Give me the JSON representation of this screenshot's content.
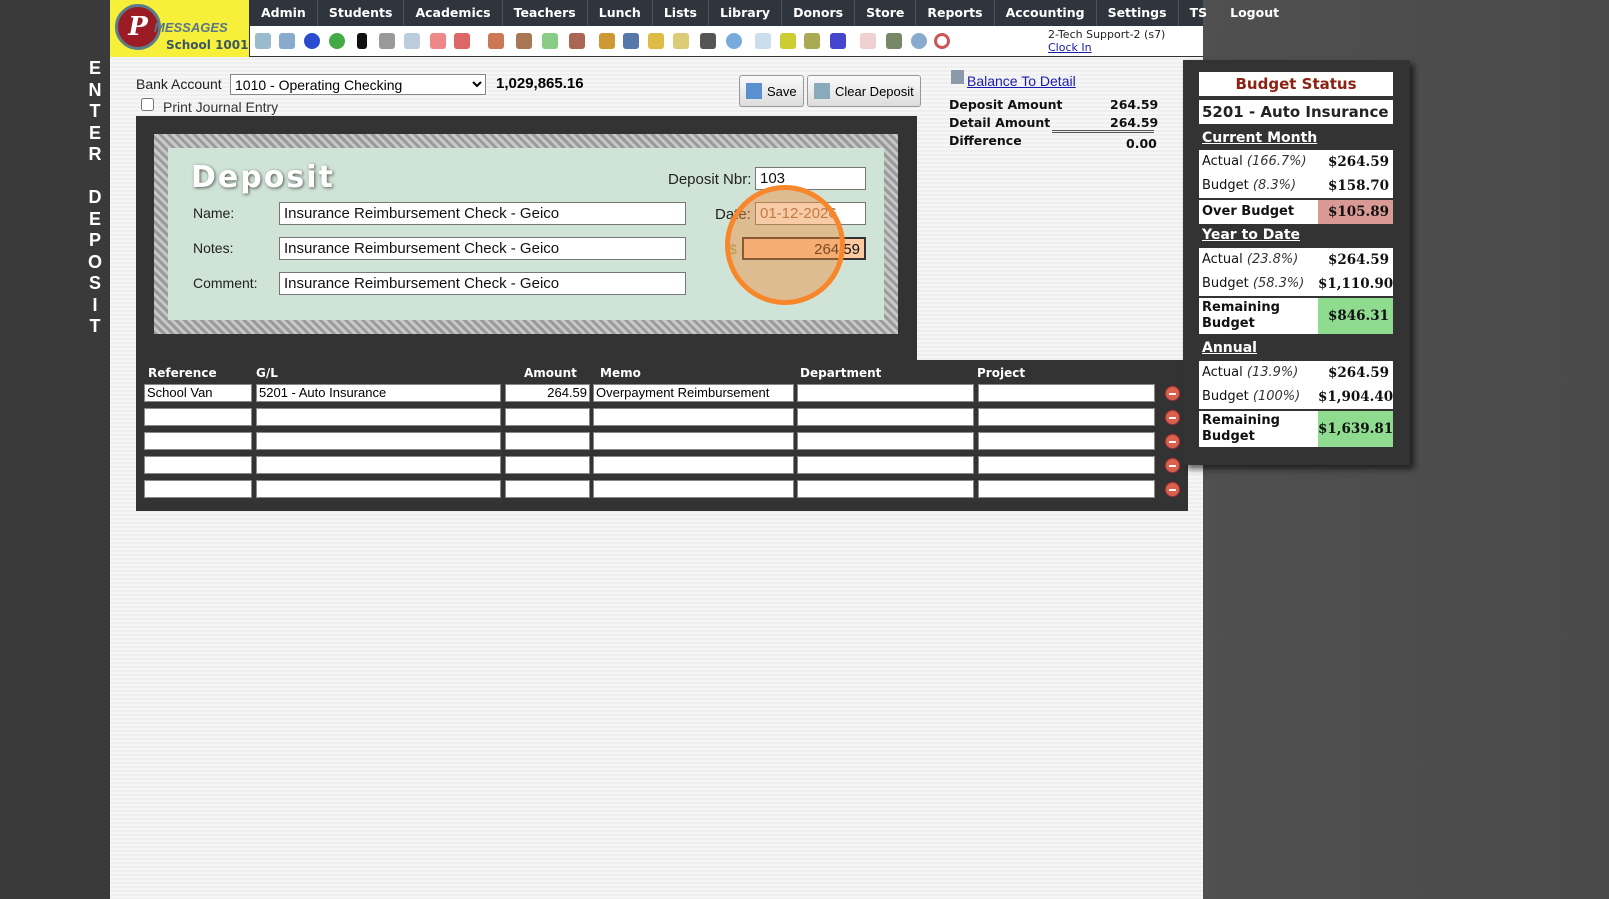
{
  "side_title": [
    "E",
    "N",
    "T",
    "E",
    "R",
    " ",
    "D",
    "E",
    "P",
    "O",
    "S",
    "I",
    "T"
  ],
  "logo": {
    "brand": "MESSAGES",
    "school": "School 1001"
  },
  "nav": [
    "Admin",
    "Students",
    "Academics",
    "Teachers",
    "Lunch",
    "Lists",
    "Library",
    "Donors",
    "Store",
    "Reports",
    "Accounting",
    "Settings",
    "TS",
    "Logout"
  ],
  "user": {
    "name": "2-Tech Support-2 (s7)",
    "clock_in": "Clock In"
  },
  "bank": {
    "label": "Bank Account",
    "selected": "1010 - Operating Checking",
    "balance": "1,029,865.16",
    "print_label": "Print Journal Entry"
  },
  "buttons": {
    "save": "Save",
    "clear": "Clear Deposit"
  },
  "balance": {
    "link": "Balance To Detail",
    "deposit_label": "Deposit Amount",
    "deposit": "264.59",
    "detail_label": "Detail Amount",
    "detail": "264.59",
    "diff_label": "Difference",
    "diff": "0.00"
  },
  "check": {
    "title": "Deposit",
    "nbr_label": "Deposit Nbr:",
    "nbr": "103",
    "date_label": "Date:",
    "date": "01-12-2026",
    "name_label": "Name:",
    "name": "Insurance Reimbursement Check - Geico",
    "notes_label": "Notes:",
    "notes": "Insurance Reimbursement Check - Geico",
    "comment_label": "Comment:",
    "comment": "Insurance Reimbursement Check - Geico",
    "currency": "$",
    "amount": "264.59"
  },
  "table": {
    "headers": [
      "Reference",
      "G/L",
      "Amount",
      "Memo",
      "Department",
      "Project"
    ],
    "rows": [
      {
        "ref": "School Van",
        "gl": "5201 - Auto Insurance",
        "amount": "264.59",
        "memo": "Overpayment Reimbursement",
        "dept": "",
        "project": ""
      },
      {},
      {},
      {},
      {}
    ]
  },
  "budget": {
    "title": "Budget Status",
    "account": "5201 - Auto Insurance",
    "current_month": {
      "heading": "Current Month",
      "actual_label": "Actual",
      "actual_pct": "(166.7%)",
      "actual": "$264.59",
      "budget_label": "Budget",
      "budget_pct": "(8.3%)",
      "budget": "$158.70",
      "over_label": "Over Budget",
      "over": "$105.89"
    },
    "ytd": {
      "heading": "Year to Date",
      "actual_label": "Actual",
      "actual_pct": "(23.8%)",
      "actual": "$264.59",
      "budget_label": "Budget",
      "budget_pct": "(58.3%)",
      "budget": "$1,110.90",
      "remain_label": "Remaining Budget",
      "remain": "$846.31"
    },
    "annual": {
      "heading": "Annual",
      "actual_label": "Actual",
      "actual_pct": "(13.9%)",
      "actual": "$264.59",
      "budget_label": "Budget",
      "budget_pct": "(100%)",
      "budget": "$1,904.40",
      "remain_label": "Remaining Budget",
      "remain": "$1,639.81"
    }
  },
  "colors": {
    "over": "#d99a96",
    "remain": "#8fdb8f",
    "highlight": "#f7872a"
  }
}
